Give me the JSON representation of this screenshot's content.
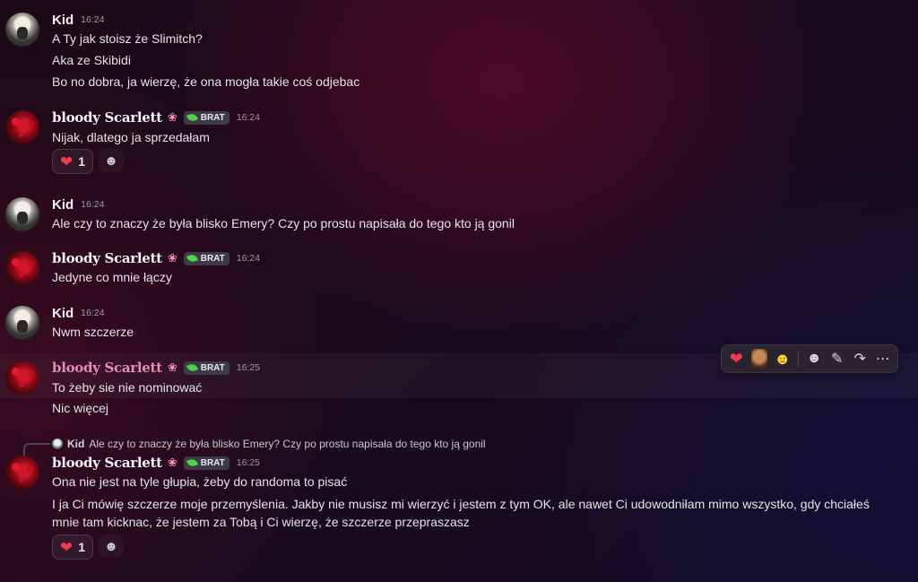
{
  "messages": {
    "m1": {
      "author": "Kid",
      "time": "16:24",
      "lines": [
        "A Ty jak stoisz że Slimitch?",
        "Aka ze Skibidi",
        "Bo no dobra, ja wierzę, że ona mogła takie coś odjebac"
      ]
    },
    "m2": {
      "author": "bloody Scarlett",
      "badge": "BRAT",
      "time": "16:24",
      "lines": [
        "Nijak, dlatego ja sprzedałam"
      ],
      "reaction_count": "1"
    },
    "m3": {
      "author": "Kid",
      "time": "16:24",
      "lines": [
        "Ale czy to znaczy że była blisko Emery? Czy po prostu napisała do tego kto ją gonil"
      ]
    },
    "m4": {
      "author": "bloody Scarlett",
      "badge": "BRAT",
      "time": "16:24",
      "lines": [
        "Jedyne co mnie łączy"
      ]
    },
    "m5": {
      "author": "Kid",
      "time": "16:24",
      "lines": [
        "Nwm szczerze"
      ]
    },
    "m6": {
      "author": "bloody Scarlett",
      "badge": "BRAT",
      "time": "16:25",
      "lines": [
        "To żeby sie nie nominować",
        "Nic więcej"
      ]
    },
    "m7": {
      "reply_author": "Kid",
      "reply_text": "Ale czy to znaczy że była blisko Emery? Czy po prostu napisała do tego kto ją gonil",
      "author": "bloody Scarlett",
      "badge": "BRAT",
      "time": "16:25",
      "lines": [
        "Ona nie jest na tyle głupia, żeby do randoma to pisać",
        "I ja Ci mówię szczerze moje przemyślenia. Jakby nie musisz mi wierzyć i jestem z tym OK, ale nawet Ci udowodniłam mimo wszystko, gdy chciałeś",
        "mnie tam kicknac, że jestem za Tobą i Ci wierzę, że szczerze przepraszasz"
      ],
      "reaction_count": "1"
    }
  },
  "icons": {
    "heart": "❤",
    "add_reaction": "☻",
    "flower": "❀",
    "starstruck": "☻",
    "edit": "✎",
    "forward": "↷",
    "more": "⋯"
  },
  "colors": {
    "heart": "#f23a4e",
    "brat_leaf": "#4ed34a",
    "highlight_name": "#e58bb7"
  }
}
